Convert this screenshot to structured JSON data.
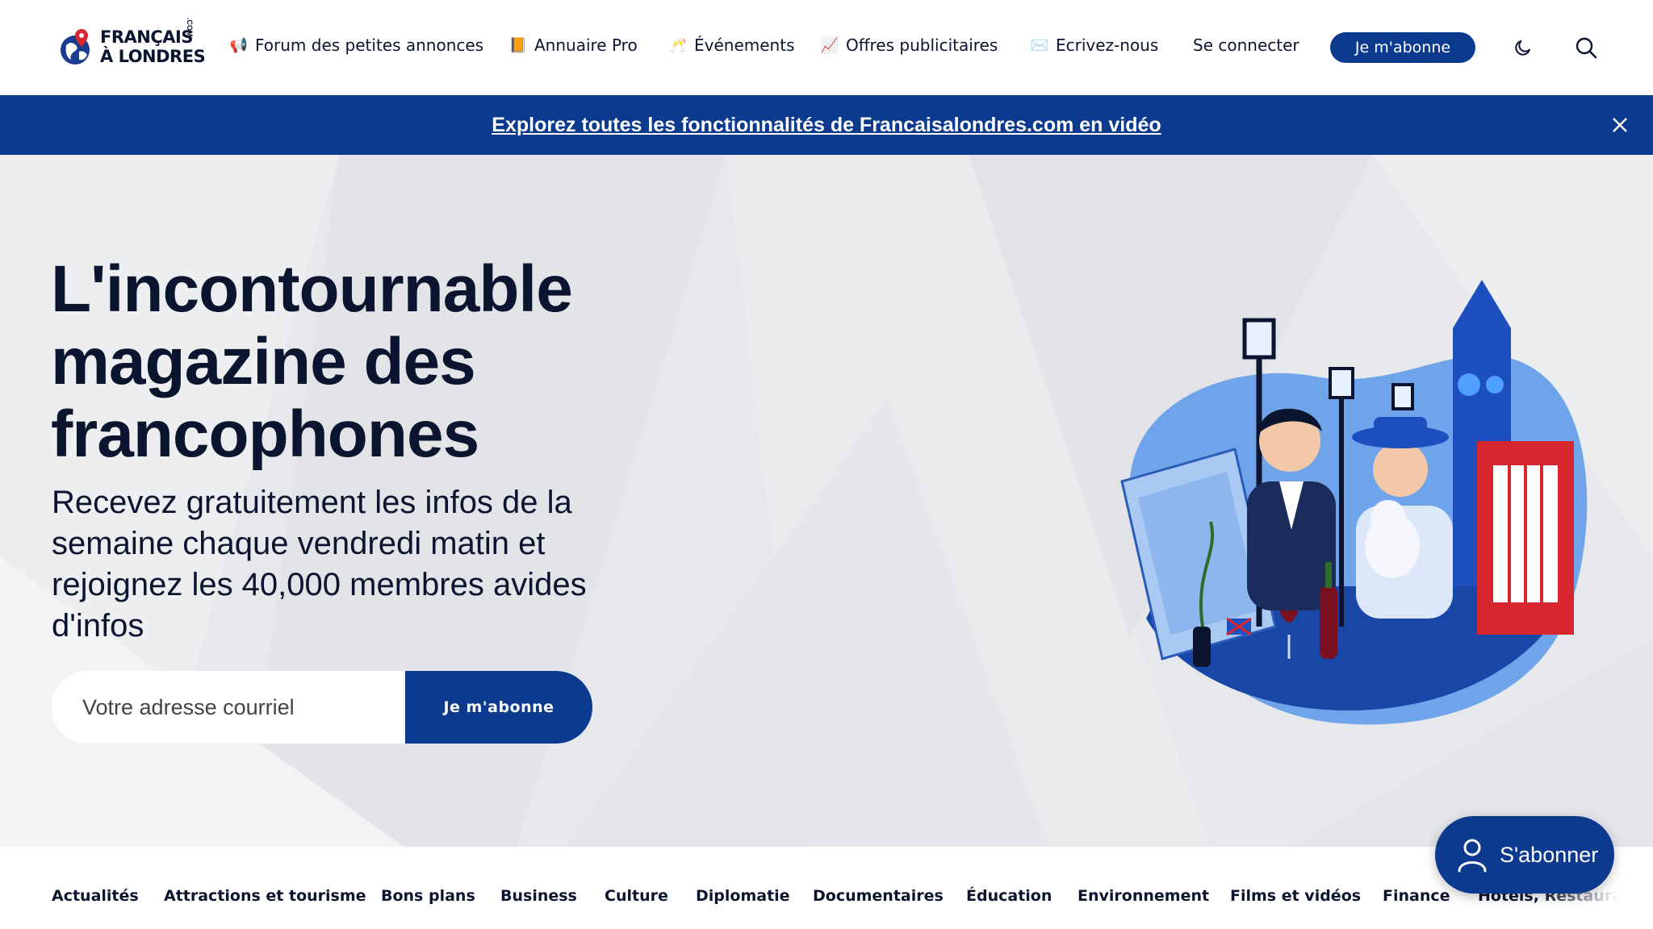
{
  "header": {
    "logo_line1": "FRANÇAIS",
    "logo_line2": "À LONDRES",
    "logo_com": ".COM",
    "nav": [
      {
        "emoji": "📢",
        "label": "Forum des petites annonces"
      },
      {
        "emoji": "📙",
        "label": "Annuaire Pro"
      },
      {
        "emoji": "🥂",
        "label": "Événements"
      },
      {
        "emoji": "📈",
        "label": "Offres publicitaires"
      },
      {
        "emoji": "✉️",
        "label": "Ecrivez-nous"
      }
    ],
    "login_label": "Se connecter",
    "subscribe_label": "Je m'abonne",
    "dark_mode_icon": "moon-icon",
    "search_icon": "search-icon",
    "brand_color": "#0b3a8f"
  },
  "banner": {
    "link_text": "Explorez toutes les fonctionnalités de Francaisalondres.com en vidéo",
    "close_icon": "close-icon"
  },
  "hero": {
    "title": "L'incontournable magazine des francophones",
    "subtitle": "Recevez gratuitement les infos de la semaine chaque vendredi matin et rejoignez les 40,000 membres avides d'infos",
    "email_placeholder": "Votre adresse courriel",
    "button_label": "Je m'abonne"
  },
  "categories": [
    "Actualités",
    "Attractions et tourisme",
    "Bons plans",
    "Business",
    "Culture",
    "Diplomatie",
    "Documentaires",
    "Éducation",
    "Environnement",
    "Films et vidéos",
    "Finance",
    "Hotels, Restaurants"
  ],
  "floating": {
    "label": "S'abonner",
    "icon": "user-icon"
  }
}
